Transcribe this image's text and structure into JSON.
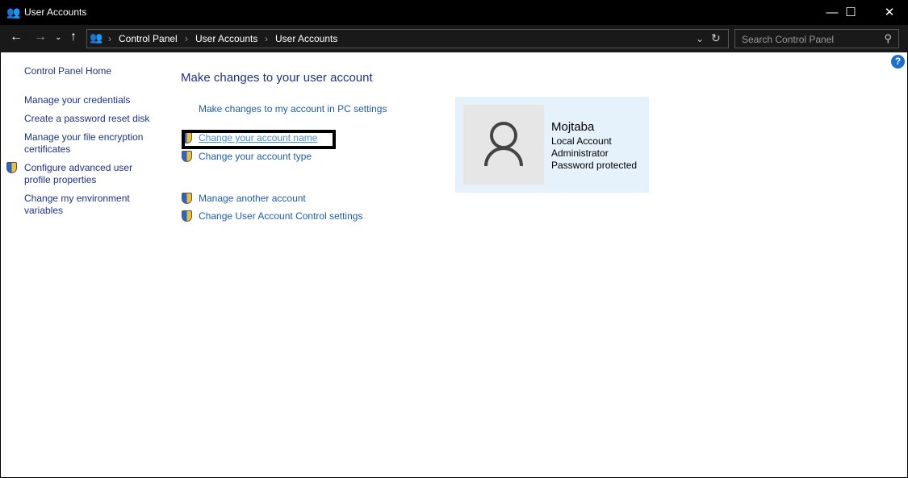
{
  "window": {
    "title": "User Accounts",
    "icon": "users-icon"
  },
  "nav": {
    "breadcrumb": [
      "Control Panel",
      "User Accounts",
      "User Accounts"
    ],
    "search_placeholder": "Search Control Panel"
  },
  "sidebar": {
    "items": [
      {
        "label": "Control Panel Home"
      },
      {
        "label": "Manage your credentials"
      },
      {
        "label": "Create a password reset disk"
      },
      {
        "label": "Manage your file encryption certificates"
      },
      {
        "label": "Configure advanced user profile properties",
        "icon": "shield-icon"
      },
      {
        "label": "Change my environment variables"
      }
    ]
  },
  "main": {
    "heading": "Make changes to your user account",
    "links": [
      {
        "label": "Make changes to my account in PC settings"
      },
      {
        "label": "Change your account name",
        "icon": "shield-icon"
      },
      {
        "label": "Change your account type",
        "icon": "shield-icon"
      },
      {
        "label": "Manage another account",
        "icon": "shield-icon"
      },
      {
        "label": "Change User Account Control settings",
        "icon": "shield-icon"
      }
    ]
  },
  "account": {
    "name": "Mojtaba",
    "type": "Local Account",
    "role": "Administrator",
    "status": "Password protected"
  },
  "help": "?"
}
